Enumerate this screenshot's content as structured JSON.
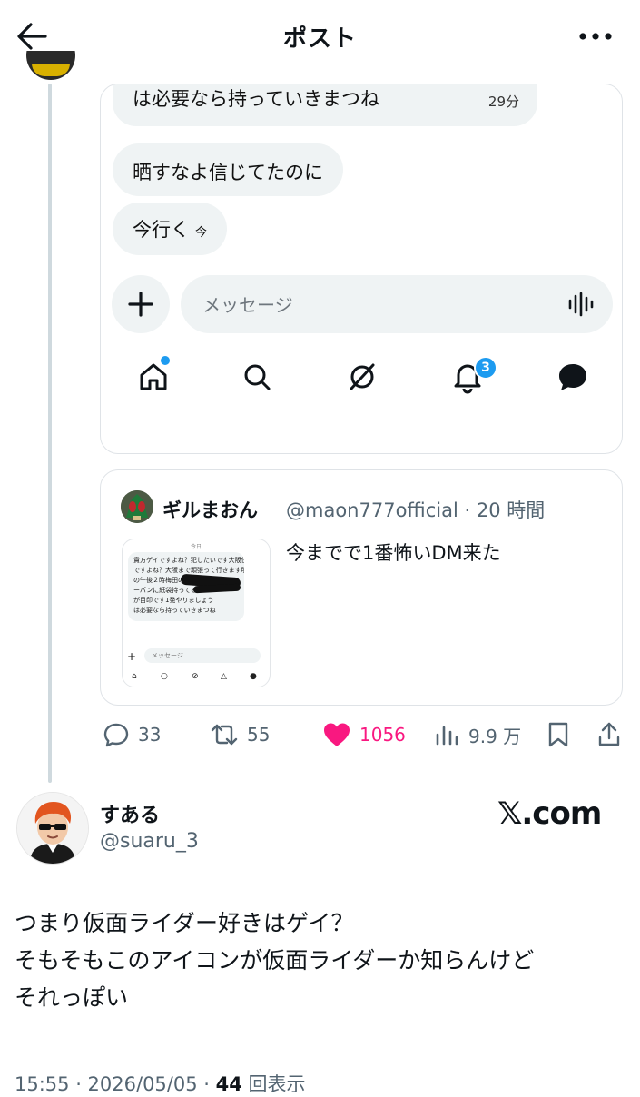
{
  "header": {
    "title": "ポスト"
  },
  "dm_screenshot": {
    "messages": [
      {
        "text": "は必要なら持っていきまつね",
        "time": "29分"
      },
      {
        "text": "晒すなよ信じてたのに"
      },
      {
        "text": "今行く",
        "small": "今"
      }
    ],
    "input_placeholder": "メッセージ",
    "notification_count": "3"
  },
  "quoted_post": {
    "author_name": "ギルまおん",
    "author_handle": "@maon777official",
    "time": "20 時間",
    "text": "今までで1番怖いDM来た",
    "thumbnail": {
      "today_label": "今日",
      "bubble_lines": [
        "貴方ゲイですよね？犯したいです大阪住み",
        "ですよね？大阪まで頑張って行きます明日",
        "の午後２時梅田の",
        "ーパンに紙袋持ってる",
        "が目印です1発やりましょう",
        "は必要なら持っていきまつね"
      ],
      "input_placeholder": "メッセージ"
    }
  },
  "actions": {
    "replies": "33",
    "reposts": "55",
    "likes": "1056",
    "views": "9.9 万"
  },
  "reply": {
    "author_name": "すある",
    "author_handle": "@suaru_3",
    "watermark": "𝕏.com",
    "text_lines": [
      "つまり仮面ライダー好きはゲイ？",
      "そもそもこのアイコンが仮面ライダーか知らんけど",
      "それっぽい"
    ],
    "timestamp": "15:55 · 2026/05/05 · ",
    "view_count": "44",
    "view_label": " 回表示"
  },
  "colors": {
    "accent": "#1d9bf0",
    "like": "#f91880",
    "muted": "#536471",
    "bubble": "#eff3f4"
  }
}
